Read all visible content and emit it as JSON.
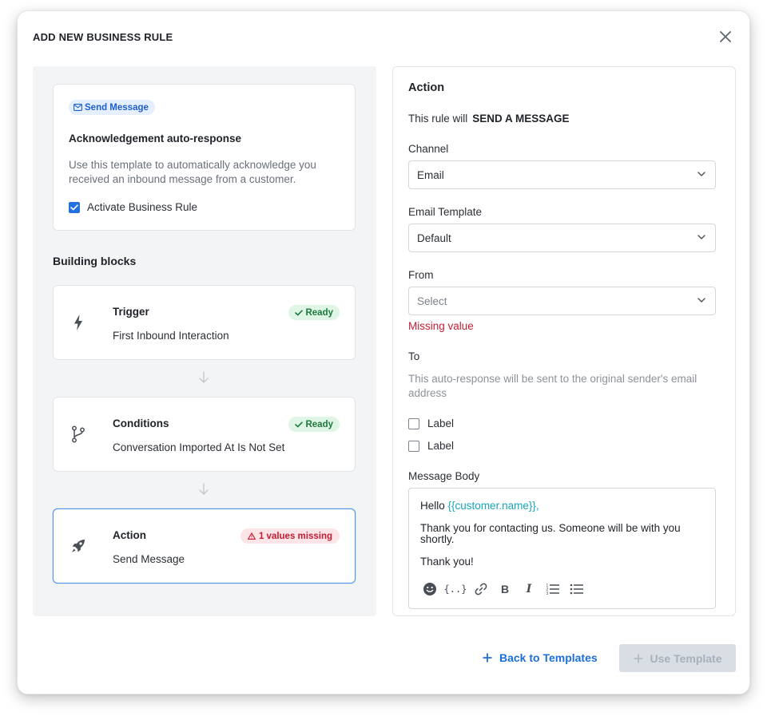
{
  "modal": {
    "title": "ADD NEW BUSINESS RULE"
  },
  "template": {
    "tag": "Send Message",
    "title": "Acknowledgement auto-response",
    "description": "Use this template to automatically acknowledge you received an inbound message from a customer.",
    "activate_label": "Activate Business Rule",
    "activate_checked": true
  },
  "building_blocks": {
    "heading": "Building blocks",
    "blocks": [
      {
        "title": "Trigger",
        "subtitle": "First Inbound Interaction",
        "status": "Ready",
        "icon": "lightning-icon"
      },
      {
        "title": "Conditions",
        "subtitle": "Conversation Imported At Is Not Set",
        "status": "Ready",
        "icon": "branch-icon"
      },
      {
        "title": "Action",
        "subtitle": "Send Message",
        "status": "1 values missing",
        "icon": "rocket-icon"
      }
    ]
  },
  "action": {
    "title": "Action",
    "rule_prefix": "This rule will",
    "rule_action": "SEND A MESSAGE",
    "channel_label": "Channel",
    "channel_value": "Email",
    "template_label": "Email Template",
    "template_value": "Default",
    "from_label": "From",
    "from_placeholder": "Select",
    "from_error": "Missing value",
    "to_label": "To",
    "to_description": "This auto-response will be sent to the original sender's email address",
    "checkbox_labels": [
      "Label",
      "Label"
    ],
    "message_body_label": "Message Body",
    "message": {
      "greeting": "Hello",
      "variable": "{{customer.name}},",
      "line2": "Thank you for contacting us. Someone will be with you shortly.",
      "line3": "Thank you!"
    },
    "toolbar": {
      "variables_label": "{..}",
      "bold_label": "B",
      "italic_label": "I"
    }
  },
  "footer": {
    "back_label": "Back to Templates",
    "use_label": "Use Template"
  },
  "colors": {
    "accent": "#1d6fd8",
    "ready_bg": "#dff5e6",
    "ready_text": "#1d7a3c",
    "error": "#c51d33",
    "variable": "#16a6b8"
  }
}
